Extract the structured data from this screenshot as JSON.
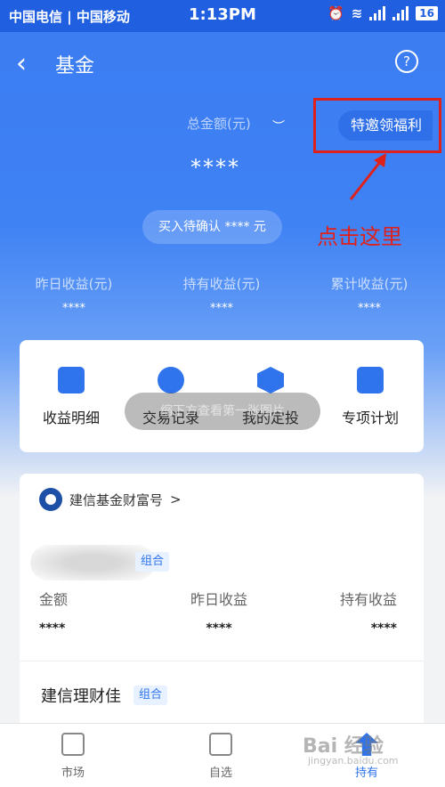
{
  "status_bar": {
    "carriers": "中国电信 | 中国移动",
    "time": "1:13PM",
    "battery": "16"
  },
  "nav": {
    "title": "基金",
    "back_icon": "chevron-left-icon",
    "help_icon": "?"
  },
  "summary": {
    "total_label": "总金额(元)",
    "eye_icon": "eye-closed-icon",
    "total_value": "****",
    "invite_label": "特邀领福利",
    "pending_text": "买入待确认 **** 元"
  },
  "annotation": {
    "text": "点击这里",
    "color": "#e0201a"
  },
  "stats": [
    {
      "label": "昨日收益(元)",
      "value": "****"
    },
    {
      "label": "持有收益(元)",
      "value": "****"
    },
    {
      "label": "累计收益(元)",
      "value": "****"
    }
  ],
  "actions": [
    {
      "label": "收益明细",
      "icon": "document-icon"
    },
    {
      "label": "交易记录",
      "icon": "record-icon"
    },
    {
      "label": "我的定投",
      "icon": "clock-shield-icon"
    },
    {
      "label": "专项计划",
      "icon": "bookmark-icon"
    }
  ],
  "toast": "缩下方查看第一张图片",
  "fund": {
    "provider": "建信基金财富号",
    "provider_arrow": ">",
    "tag": "组合",
    "columns": [
      {
        "label": "金额",
        "value": "****"
      },
      {
        "label": "昨日收益",
        "value": "****"
      },
      {
        "label": "持有收益",
        "value": "****"
      }
    ],
    "second_name": "建信理财佳",
    "second_tag": "组合"
  },
  "tabs": [
    {
      "label": "市场",
      "icon": "market-icon"
    },
    {
      "label": "自选",
      "icon": "add-box-icon"
    },
    {
      "label": "持有",
      "icon": "holdings-icon"
    }
  ],
  "watermark": {
    "main": "Bai 经验",
    "sub": "jingyan.baidu.com"
  },
  "colors": {
    "primary": "#3b7cf2",
    "accent": "#2f74ec",
    "annotation": "#e0201a"
  }
}
